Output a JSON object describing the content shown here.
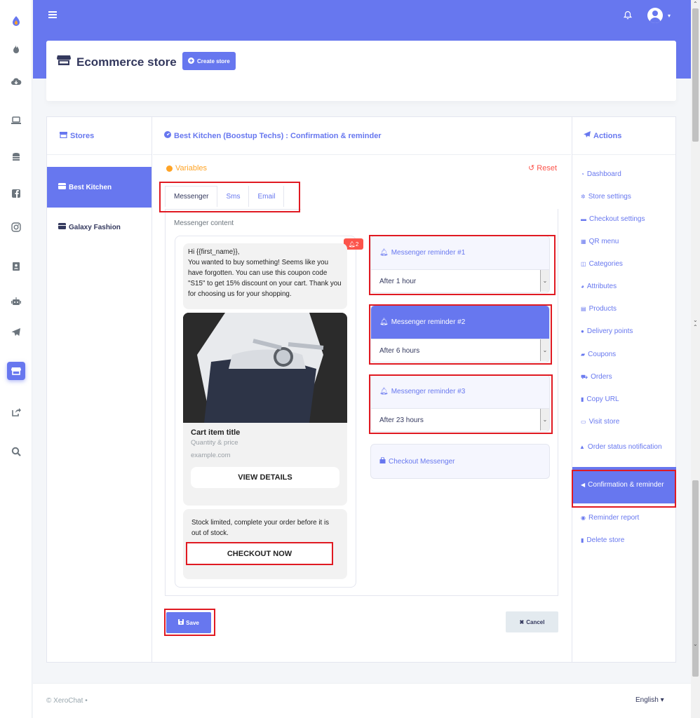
{
  "topbar": {
    "menu_icon": "hamburger-icon",
    "bell_icon": "bell-icon",
    "avatar_icon": "user-avatar-icon",
    "accent": "#6777ef"
  },
  "rail": {
    "icons": [
      "logo-icon",
      "fire-icon",
      "cloud-download-icon",
      "laptop-icon",
      "coins-icon",
      "facebook-icon",
      "instagram-icon",
      "contact-book-icon",
      "robot-icon",
      "telegram-icon",
      "store-icon",
      "share-icon",
      "search-icon"
    ],
    "active": "store-icon"
  },
  "section": {
    "title": "Ecommerce store",
    "create_button": "Create store"
  },
  "stores": {
    "header": "Stores",
    "items": [
      {
        "label": "Best Kitchen",
        "active": true
      },
      {
        "label": "Galaxy Fashion",
        "active": false
      }
    ]
  },
  "content": {
    "header": "Best Kitchen (Boostup Techs) : Confirmation & reminder",
    "variables_label": "Variables",
    "reset_label": "Reset",
    "tabs": [
      {
        "label": "Messenger",
        "active": true
      },
      {
        "label": "Sms"
      },
      {
        "label": "Email"
      }
    ],
    "messenger_content_label": "Messenger content",
    "preview": {
      "badge_count": "2",
      "message": "Hi {{first_name}},\nYou wanted to buy something! Seems like you have forgotten. You can use this coupon code \"S15\" to get 15% discount on your cart. Thank you for choosing us for your shopping.",
      "card_title": "Cart item title",
      "card_subtitle": "Quantity & price",
      "card_url": "example.com",
      "view_button": "VIEW DETAILS",
      "stock_text": "Stock limited, complete your order before it is out of stock.",
      "checkout_button": "CHECKOUT NOW"
    },
    "reminders": [
      {
        "label": "Messenger reminder #1",
        "value": "After 1 hour",
        "active": false
      },
      {
        "label": "Messenger reminder #2",
        "value": "After 6 hours",
        "active": true
      },
      {
        "label": "Messenger reminder #3",
        "value": "After 23 hours",
        "active": false
      }
    ],
    "checkout_messenger": "Checkout Messenger",
    "save_button": "Save",
    "cancel_button": "Cancel"
  },
  "actions": {
    "header": "Actions",
    "items": [
      {
        "label": "Dashboard",
        "icon": "tachometer-icon"
      },
      {
        "label": "Store settings",
        "icon": "cog-icon"
      },
      {
        "label": "Checkout settings",
        "icon": "credit-card-icon"
      },
      {
        "label": "QR menu",
        "icon": "qrcode-icon"
      },
      {
        "label": "Categories",
        "icon": "columns-icon"
      },
      {
        "label": "Attributes",
        "icon": "palette-icon"
      },
      {
        "label": "Products",
        "icon": "boxes-icon"
      },
      {
        "label": "Delivery points",
        "icon": "map-marker-icon"
      },
      {
        "label": "Coupons",
        "icon": "tags-icon"
      },
      {
        "label": "Orders",
        "icon": "cart-icon"
      },
      {
        "label": "Copy URL",
        "icon": "copy-icon"
      },
      {
        "label": "Visit store",
        "icon": "window-icon"
      },
      {
        "label": "Order status notification",
        "icon": "bell-icon"
      },
      {
        "label": "Confirmation & reminder",
        "icon": "bullhorn-icon",
        "active": true
      },
      {
        "label": "Reminder report",
        "icon": "eye-icon"
      },
      {
        "label": "Delete store",
        "icon": "trash-icon"
      }
    ]
  },
  "footer": {
    "copyright": "© XeroChat",
    "language": "English"
  }
}
